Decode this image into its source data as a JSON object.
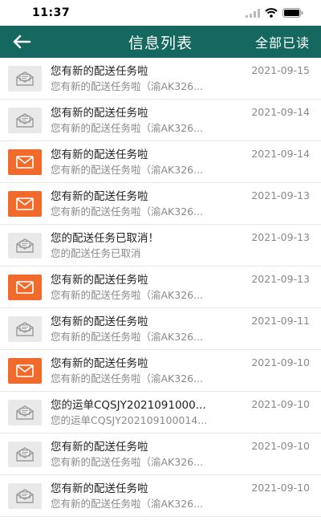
{
  "status_bar": {
    "time": "11:37"
  },
  "header": {
    "title": "信息列表",
    "mark_all_read": "全部已读"
  },
  "colors": {
    "header_bg": "#14685f",
    "unread_icon": "#f06a2c",
    "read_icon": "#e9e9e9"
  },
  "messages": [
    {
      "title": "您有新的配送任务啦",
      "summary": "您有新的配送任务啦（渝AK326...",
      "date": "2021-09-15",
      "unread": false
    },
    {
      "title": "您有新的配送任务啦",
      "summary": "您有新的配送任务啦（渝AK326...",
      "date": "2021-09-14",
      "unread": false
    },
    {
      "title": "您有新的配送任务啦",
      "summary": "您有新的配送任务啦（渝AK326...",
      "date": "2021-09-14",
      "unread": true
    },
    {
      "title": "您有新的配送任务啦",
      "summary": "您有新的配送任务啦（渝AK326...",
      "date": "2021-09-13",
      "unread": true
    },
    {
      "title": "您的配送任务已取消！",
      "summary": "您的配送任务已取消",
      "date": "2021-09-13",
      "unread": false
    },
    {
      "title": "您有新的配送任务啦",
      "summary": "您有新的配送任务啦（渝AK326...",
      "date": "2021-09-13",
      "unread": true
    },
    {
      "title": "您有新的配送任务啦",
      "summary": "您有新的配送任务啦（渝AK326...",
      "date": "2021-09-11",
      "unread": false
    },
    {
      "title": "您有新的配送任务啦",
      "summary": "您有新的配送任务啦（渝AK326...",
      "date": "2021-09-10",
      "unread": true
    },
    {
      "title": "您的运单CQSJY2021091000...",
      "summary": "您的运单CQSJY202109100014...",
      "date": "2021-09-10",
      "unread": false
    },
    {
      "title": "您有新的配送任务啦",
      "summary": "您有新的配送任务啦（渝AK326...",
      "date": "2021-09-10",
      "unread": false
    },
    {
      "title": "您有新的配送任务啦",
      "summary": "您有新的配送任务啦（渝AK326...",
      "date": "2021-09-10",
      "unread": false
    }
  ]
}
